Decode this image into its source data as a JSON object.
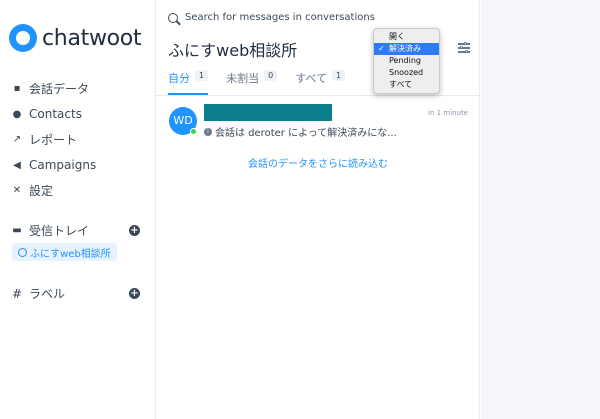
{
  "sidebar": {
    "logo_text": "chatwoot",
    "nav": [
      {
        "label": "会話データ",
        "icon": "chat-icon"
      },
      {
        "label": "Contacts",
        "icon": "person-icon"
      },
      {
        "label": "レポート",
        "icon": "chart-icon"
      },
      {
        "label": "Campaigns",
        "icon": "megaphone-icon"
      },
      {
        "label": "設定",
        "icon": "tools-icon"
      }
    ],
    "inboxes_label": "受信トレイ",
    "inbox_item": "ふにすweb相談所",
    "labels_label": "ラベル"
  },
  "panel": {
    "search_placeholder": "Search for messages in conversations",
    "title": "ふにすweb相談所",
    "tabs": [
      {
        "label": "自分",
        "count": "1"
      },
      {
        "label": "未割当",
        "count": "0"
      },
      {
        "label": "すべて",
        "count": "1"
      }
    ],
    "conversation": {
      "avatar_initials": "WD",
      "time": "in 1 minute",
      "preview": "会話は deroter によって解決済みにな..."
    },
    "load_more": "会話のデータをさらに読み込む"
  },
  "status_dropdown": {
    "options": [
      "開く",
      "解決済み",
      "Pending",
      "Snoozed",
      "すべて"
    ],
    "selected": "解決済み"
  },
  "colors": {
    "accent": "#1f93ff",
    "redacted_name": "#0b7f90",
    "online": "#44ce4b"
  }
}
